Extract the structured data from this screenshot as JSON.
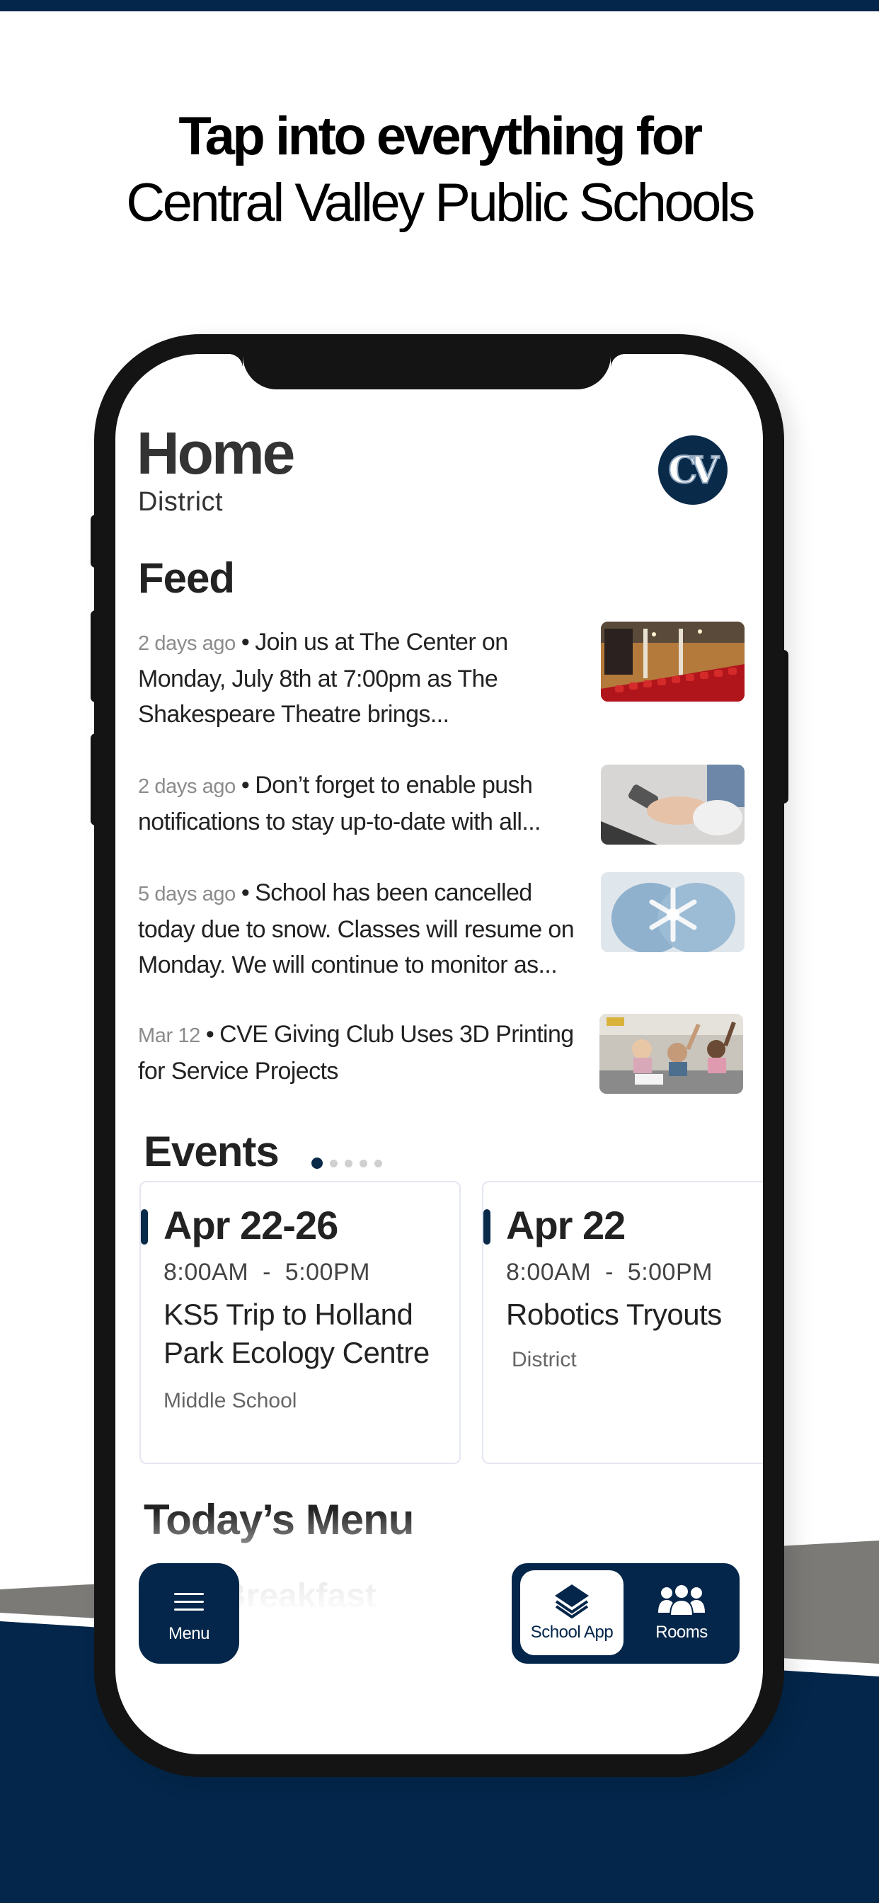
{
  "colors": {
    "brand_navy": "#03264a",
    "stripe_gray": "#7b7a77",
    "phone_bezel": "#141414",
    "pager_inactive": "#d0d0d0"
  },
  "headline": {
    "line1": "Tap into everything for",
    "line2": "Central Valley Public Schools"
  },
  "app": {
    "header": {
      "title": "Home",
      "subtitle": "District",
      "logo_text": "CV",
      "logo_icon": "school-logo-icon"
    },
    "feed": {
      "title": "Feed",
      "separator": "•",
      "items": [
        {
          "meta": "2 days ago",
          "text": "Join us at The Center on Monday, July 8th at 7:00pm as The Shakespeare Theatre brings...",
          "image": "theater-seats-image"
        },
        {
          "meta": "2 days ago",
          "text": "Don’t forget to enable push notifications to stay up-to-date with all...",
          "image": "phone-in-hands-image"
        },
        {
          "meta": "5 days ago",
          "text": "School has been cancelled today due to snow. Classes will resume on Monday. We will continue to monitor as...",
          "image": "snowflake-mittens-image"
        },
        {
          "meta": "Mar 12",
          "text": "CVE Giving Club Uses 3D Printing for Service Projects",
          "image": "classroom-students-image"
        }
      ]
    },
    "events": {
      "title": "Events",
      "pager": {
        "count": 5,
        "active_index": 0
      },
      "items": [
        {
          "date": "Apr 22-26",
          "time": "8:00AM  -  5:00PM",
          "name": "KS5 Trip to Holland Park Ecology Centre",
          "location": "Middle School"
        },
        {
          "date": "Apr 22",
          "time": "8:00AM  -  5:00PM",
          "name": "Robotics Tryouts",
          "location": "District"
        }
      ]
    },
    "todays_menu": {
      "title": "Today’s Menu",
      "first_meal": "Breakfast"
    },
    "bottom_nav": {
      "menu": {
        "label": "Menu",
        "icon": "hamburger-icon"
      },
      "tabs": [
        {
          "label": "School App",
          "icon": "layers-icon",
          "active": true
        },
        {
          "label": "Rooms",
          "icon": "people-group-icon",
          "active": false
        }
      ]
    }
  }
}
